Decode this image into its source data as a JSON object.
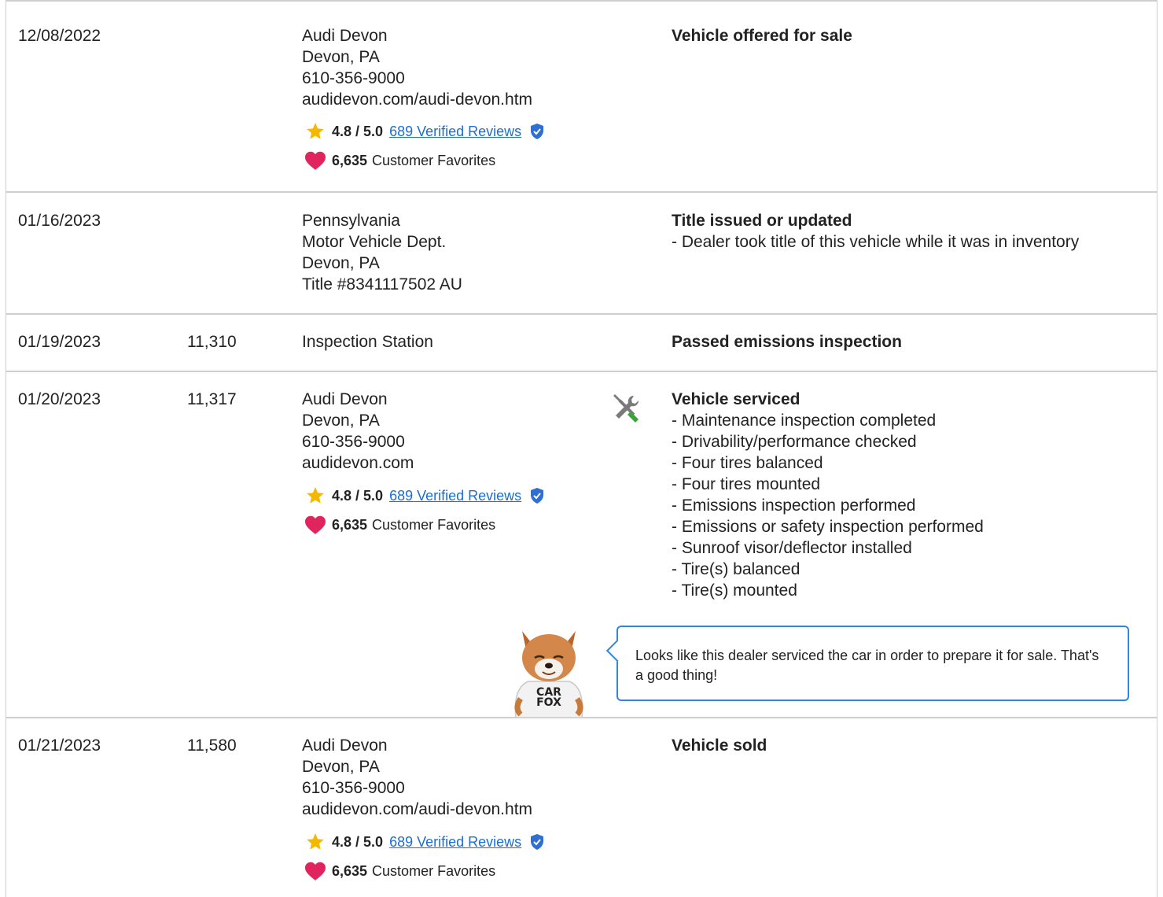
{
  "records": [
    {
      "date": "12/08/2022",
      "odometer": "",
      "source": [
        "Audi Devon",
        "Devon, PA",
        "610-356-9000",
        "audidevon.com/audi-devon.htm"
      ],
      "rating": "4.8 / 5.0",
      "reviews_link": "689 Verified Reviews",
      "favorites_count": "6,635",
      "favorites_label": "Customer Favorites",
      "comment_title": "Vehicle offered for sale",
      "comment_lines": []
    },
    {
      "date": "01/16/2023",
      "odometer": "",
      "source": [
        "Pennsylvania",
        "Motor Vehicle Dept.",
        "Devon, PA",
        "Title #8341117502 AU"
      ],
      "comment_title": "Title issued or updated",
      "comment_lines": [
        "- Dealer took title of this vehicle while it was in inventory"
      ]
    },
    {
      "date": "01/19/2023",
      "odometer": "11,310",
      "source": [
        "Inspection Station"
      ],
      "comment_title": "Passed emissions inspection",
      "comment_lines": []
    },
    {
      "date": "01/20/2023",
      "odometer": "11,317",
      "source": [
        "Audi Devon",
        "Devon, PA",
        "610-356-9000",
        "audidevon.com"
      ],
      "rating": "4.8 / 5.0",
      "reviews_link": "689 Verified Reviews",
      "favorites_count": "6,635",
      "favorites_label": "Customer Favorites",
      "icon": "service-wrench-icon",
      "comment_title": "Vehicle serviced",
      "comment_lines": [
        "- Maintenance inspection completed",
        "- Drivability/performance checked",
        "- Four tires balanced",
        "- Four tires mounted",
        "- Emissions inspection performed",
        "- Emissions or safety inspection performed",
        "- Sunroof visor/deflector installed",
        "- Tire(s) balanced",
        "- Tire(s) mounted"
      ],
      "tip": "Looks like this dealer serviced the car in order to prepare it for sale. That's a good thing!",
      "mascot_text": [
        "CAR",
        "FOX"
      ]
    },
    {
      "date": "01/21/2023",
      "odometer": "11,580",
      "source": [
        "Audi Devon",
        "Devon, PA",
        "610-356-9000",
        "audidevon.com/audi-devon.htm"
      ],
      "rating": "4.8 / 5.0",
      "reviews_link": "689 Verified Reviews",
      "favorites_count": "6,635",
      "favorites_label": "Customer Favorites",
      "comment_title": "Vehicle sold",
      "comment_lines": []
    }
  ],
  "colors": {
    "link": "#1a6fd4",
    "star": "#f5b800",
    "heart": "#e0245e",
    "verified": "#2e6fd1",
    "tip_border": "#2e86de"
  }
}
